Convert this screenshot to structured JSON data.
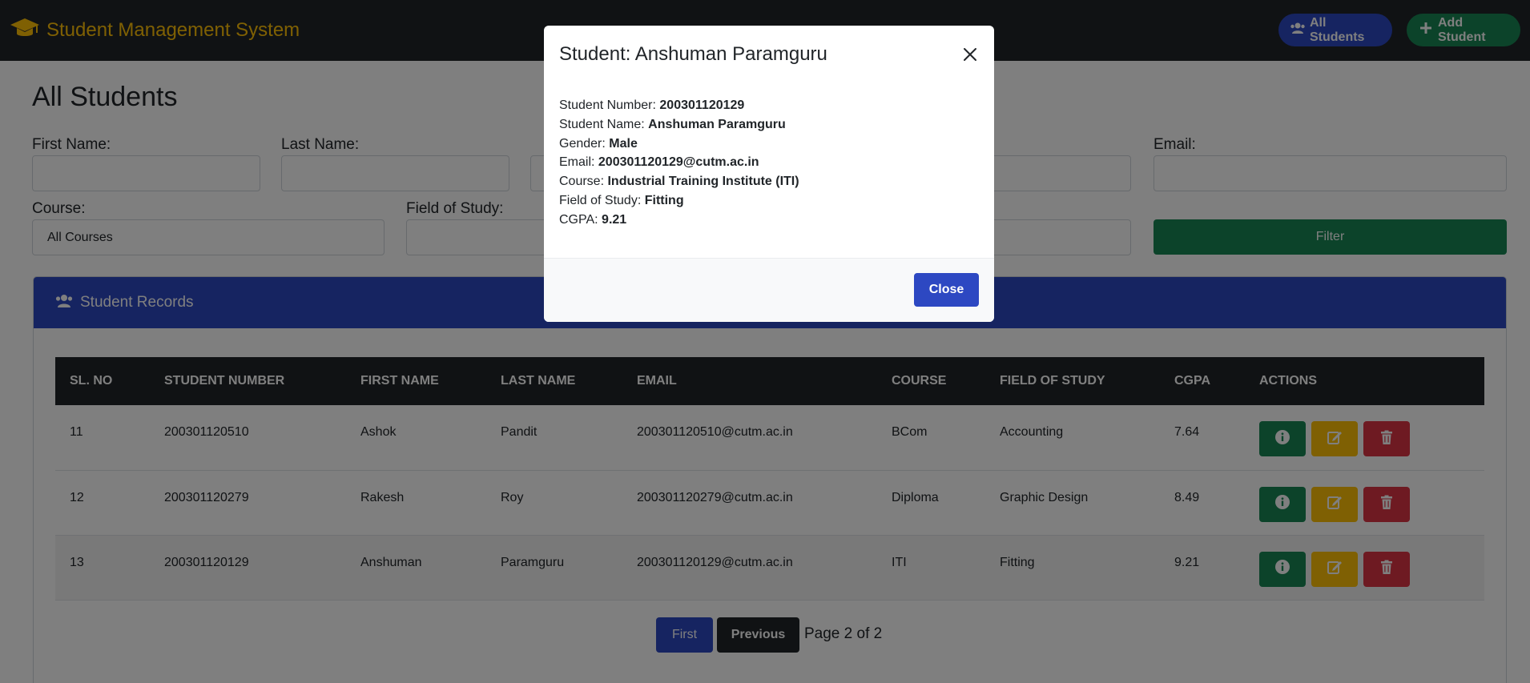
{
  "navbar": {
    "brand": "Student Management System",
    "all_students": "All Students",
    "add_student": "Add Student"
  },
  "page": {
    "title": "All Students"
  },
  "filters": {
    "first_name_label": "First Name:",
    "last_name_label": "Last Name:",
    "email_label": "Email:",
    "course_label": "Course:",
    "course_value": "All Courses",
    "field_label": "Field of Study:",
    "filter_button": "Filter"
  },
  "card": {
    "header": "Student Records"
  },
  "table": {
    "headers": [
      "SL. NO",
      "STUDENT NUMBER",
      "FIRST NAME",
      "LAST NAME",
      "EMAIL",
      "COURSE",
      "FIELD OF STUDY",
      "CGPA",
      "ACTIONS"
    ],
    "rows": [
      [
        "11",
        "200301120510",
        "Ashok",
        "Pandit",
        "200301120510@cutm.ac.in",
        "BCom",
        "Accounting",
        "7.64"
      ],
      [
        "12",
        "200301120279",
        "Rakesh",
        "Roy",
        "200301120279@cutm.ac.in",
        "Diploma",
        "Graphic Design",
        "8.49"
      ],
      [
        "13",
        "200301120129",
        "Anshuman",
        "Paramguru",
        "200301120129@cutm.ac.in",
        "ITI",
        "Fitting",
        "9.21"
      ]
    ]
  },
  "pagination": {
    "first": "First",
    "previous": "Previous",
    "info": "Page 2 of 2"
  },
  "modal": {
    "title": "Student: Anshuman Paramguru",
    "fields": [
      {
        "label": "Student Number: ",
        "value": "200301120129"
      },
      {
        "label": "Student Name: ",
        "value": "Anshuman Paramguru"
      },
      {
        "label": "Gender: ",
        "value": "Male"
      },
      {
        "label": "Email: ",
        "value": "200301120129@cutm.ac.in"
      },
      {
        "label": "Course: ",
        "value": "Industrial Training Institute (ITI)"
      },
      {
        "label": "Field of Study: ",
        "value": "Fitting"
      },
      {
        "label": "CGPA: ",
        "value": "9.21"
      }
    ],
    "close_button": "Close"
  },
  "colors": {
    "primary": "#2d48c2",
    "success": "#198754",
    "warning": "#ffc107",
    "danger": "#dc3545",
    "dark": "#212529"
  }
}
